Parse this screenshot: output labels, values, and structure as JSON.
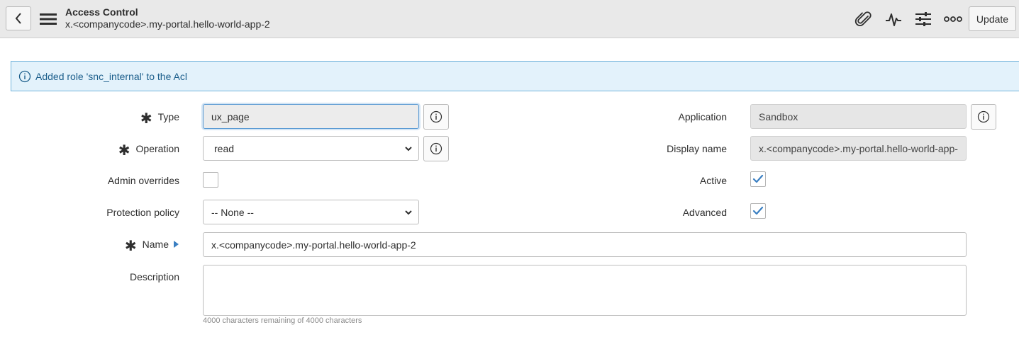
{
  "header": {
    "title": "Access Control",
    "subtitle": "x.<companycode>.my-portal.hello-world-app-2",
    "update_label": "Update",
    "icons": [
      "back-icon",
      "hamburger-menu-icon",
      "paperclip-icon",
      "activity-pulse-icon",
      "sliders-icon",
      "more-options-icon"
    ]
  },
  "banner": {
    "message": "Added role 'snc_internal' to the Acl"
  },
  "form": {
    "type": {
      "label": "Type",
      "value": "ux_page",
      "required": true
    },
    "operation": {
      "label": "Operation",
      "value": "read",
      "required": true
    },
    "admin_overrides": {
      "label": "Admin overrides",
      "checked": false
    },
    "protection_policy": {
      "label": "Protection policy",
      "value": "-- None --"
    },
    "name": {
      "label": "Name",
      "value": "x.<companycode>.my-portal.hello-world-app-2",
      "required": true
    },
    "description": {
      "label": "Description",
      "value": "",
      "char_count": "4000 characters remaining of 4000 characters"
    },
    "application": {
      "label": "Application",
      "value": "Sandbox"
    },
    "display_name": {
      "label": "Display name",
      "value": "x.<companycode>.my-portal.hello-world-app-"
    },
    "active": {
      "label": "Active",
      "checked": true
    },
    "advanced": {
      "label": "Advanced",
      "checked": true
    }
  },
  "colors": {
    "accent": "#5d9cd4",
    "banner_bg": "#e3f2fb",
    "banner_text": "#1c5f8c",
    "checkmark": "#3a7fc2"
  }
}
